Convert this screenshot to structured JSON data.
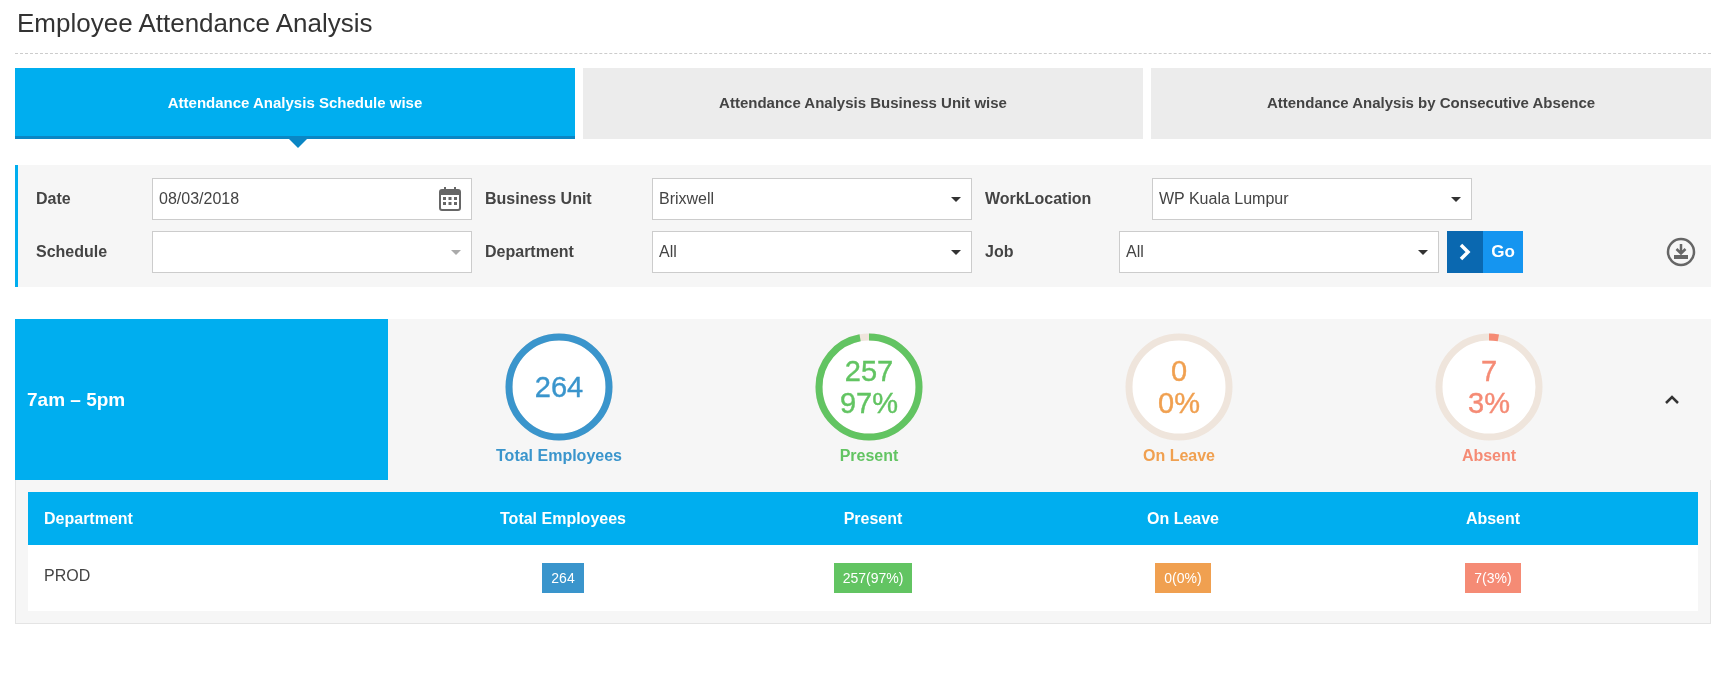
{
  "page_title": "Employee Attendance Analysis",
  "tabs": [
    {
      "label": "Attendance Analysis Schedule wise",
      "selected": true
    },
    {
      "label": "Attendance Analysis Business Unit wise",
      "selected": false
    },
    {
      "label": "Attendance Analysis by Consecutive Absence",
      "selected": false
    }
  ],
  "filter_rows": [
    [
      {
        "label": "Date",
        "kind": "date",
        "value": "08/03/2018"
      },
      {
        "label": "Business Unit",
        "kind": "select",
        "value": "Brixwell"
      },
      {
        "label": "WorkLocation",
        "kind": "select",
        "value": "WP Kuala Lumpur"
      }
    ],
    [
      {
        "label": "Schedule",
        "kind": "select-muted"
      },
      {
        "label": "Department",
        "kind": "select",
        "value": "All"
      },
      {
        "label": "Job",
        "kind": "select",
        "value": "All"
      }
    ]
  ],
  "go_button": "Go",
  "schedule": {
    "name": "7am – 5pm",
    "expanded": true,
    "stats": [
      {
        "label": "Total Employees",
        "count": "264",
        "level": 1,
        "color": "#3a95cc"
      },
      {
        "label": "Present",
        "count": "257",
        "percent": "97%",
        "level": 0.97,
        "color": "#62c462"
      },
      {
        "label": "On Leave",
        "count": "0",
        "percent": "0%",
        "level": 0,
        "color": "#f0a050"
      },
      {
        "label": "Absent",
        "count": "7",
        "percent": "3%",
        "level": 0.03,
        "color": "#f58b75"
      }
    ]
  },
  "table": {
    "columns": [
      "Department",
      "Total Employees",
      "Present",
      "On Leave",
      "Absent"
    ],
    "rows": [
      [
        {
          "text": "PROD"
        },
        {
          "text": "264",
          "color": "#3a95cc"
        },
        {
          "text": "257(97%)",
          "color": "#62c462"
        },
        {
          "text": "0(0%)",
          "color": "#f0a050"
        },
        {
          "text": "7(3%)",
          "color": "#f58b75"
        }
      ]
    ]
  }
}
